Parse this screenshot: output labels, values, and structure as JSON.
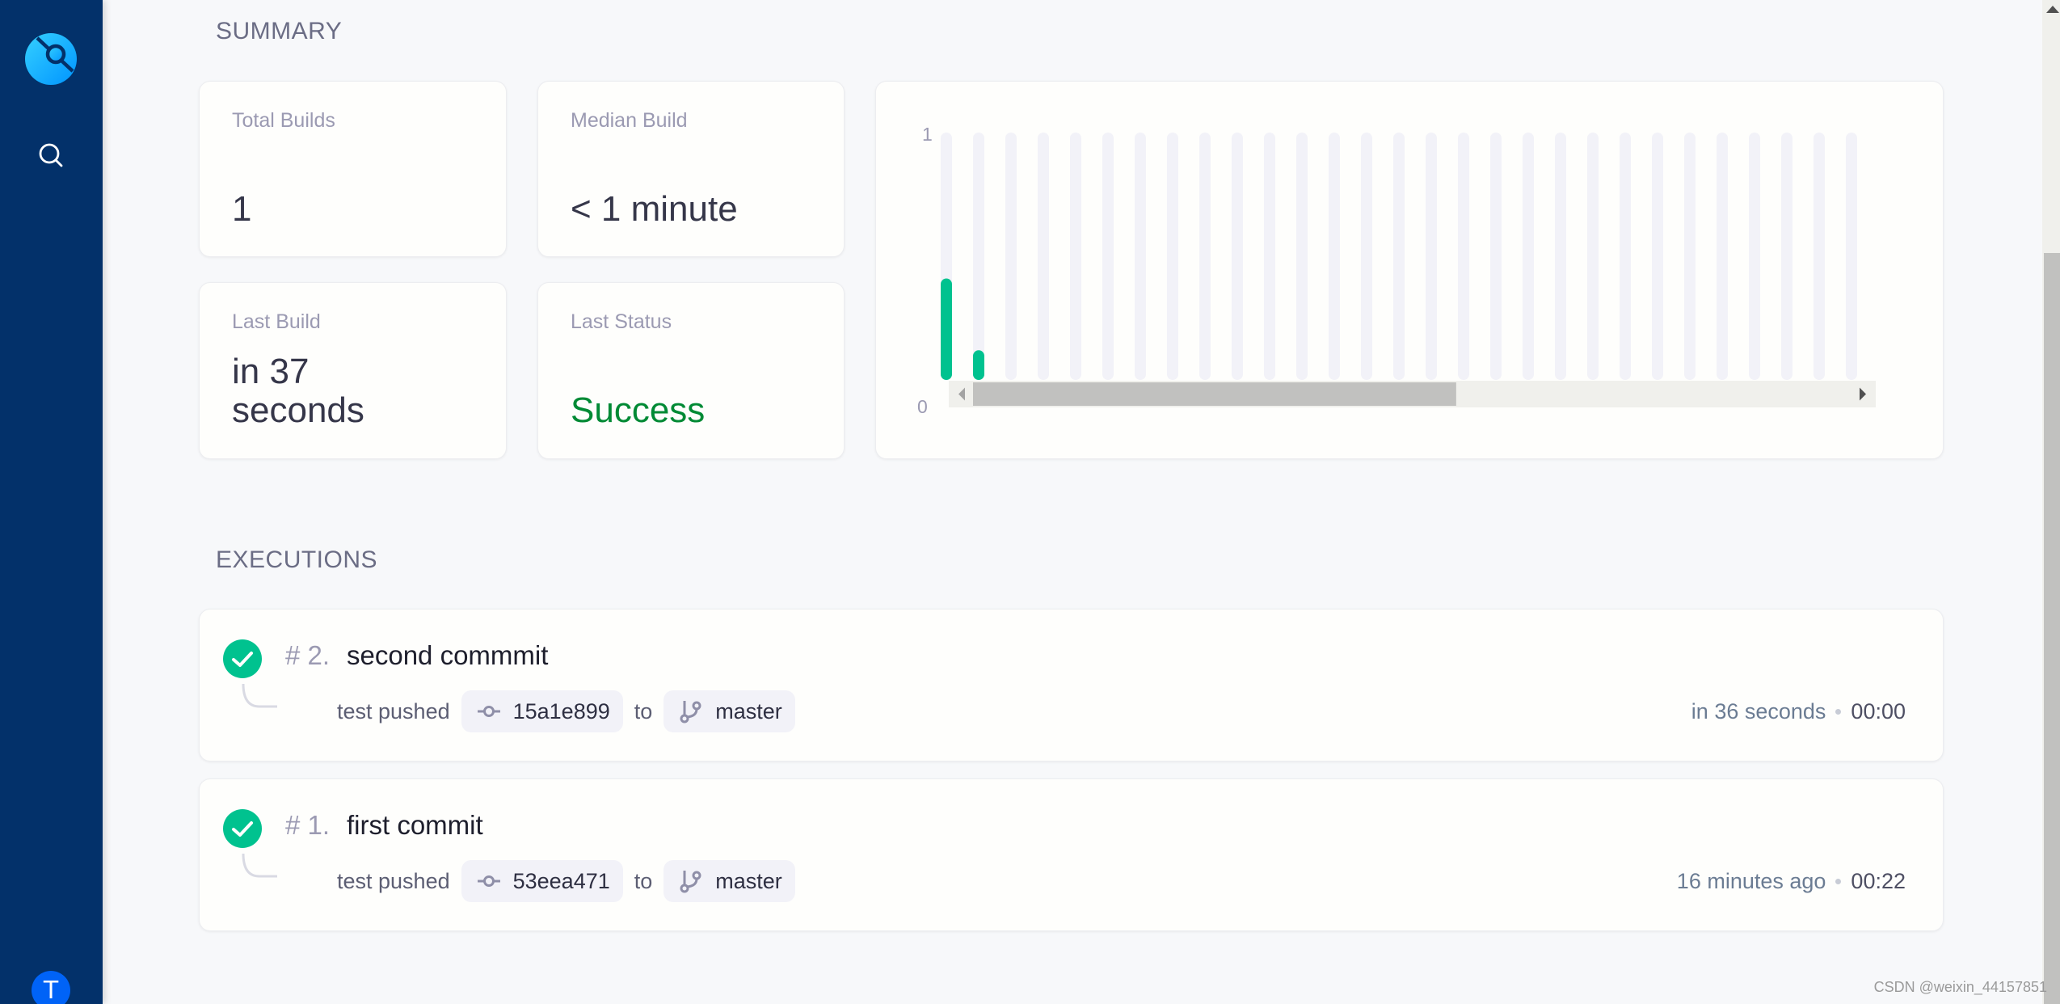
{
  "sidebar": {
    "logo_icon": "drone-logo-icon",
    "search_icon": "search-icon",
    "avatar_initial": "T"
  },
  "summary": {
    "title": "SUMMARY",
    "stats": [
      {
        "label": "Total Builds",
        "value": "1"
      },
      {
        "label": "Median Build",
        "value": "< 1 minute"
      },
      {
        "label": "Last Build",
        "value": "in 37 seconds"
      },
      {
        "label": "Last Status",
        "value": "Success"
      }
    ]
  },
  "chart_data": {
    "type": "bar",
    "title": "",
    "xlabel": "",
    "ylabel": "",
    "ylim": [
      0,
      1
    ],
    "yticks": [
      "0",
      "1"
    ],
    "bar_count": 29,
    "values": [
      0.41,
      0.12,
      0,
      0,
      0,
      0,
      0,
      0,
      0,
      0,
      0,
      0,
      0,
      0,
      0,
      0,
      0,
      0,
      0,
      0,
      0,
      0,
      0,
      0,
      0,
      0,
      0,
      0,
      0
    ],
    "bar_color": "#00c28f",
    "track_color": "#f2f2f8",
    "grid": false,
    "scrollbar_position": 0,
    "scrollbar_visible_fraction": 0.55
  },
  "executions": {
    "title": "EXECUTIONS",
    "items": [
      {
        "status": "success",
        "number": "# 2.",
        "title": "second commmit",
        "author_action": "test pushed",
        "commit": "15a1e899",
        "to_label": "to",
        "branch": "master",
        "time": "in 36 seconds",
        "duration": "00:00"
      },
      {
        "status": "success",
        "number": "# 1.",
        "title": "first commit",
        "author_action": "test pushed",
        "commit": "53eea471",
        "to_label": "to",
        "branch": "master",
        "time": "16 minutes ago",
        "duration": "00:22"
      }
    ]
  },
  "colors": {
    "sidebar_bg": "#03316a",
    "success": "#00c28f",
    "success_text": "#008a35",
    "avatar_bg": "#0063f7"
  },
  "watermark": "CSDN @weixin_44157851"
}
